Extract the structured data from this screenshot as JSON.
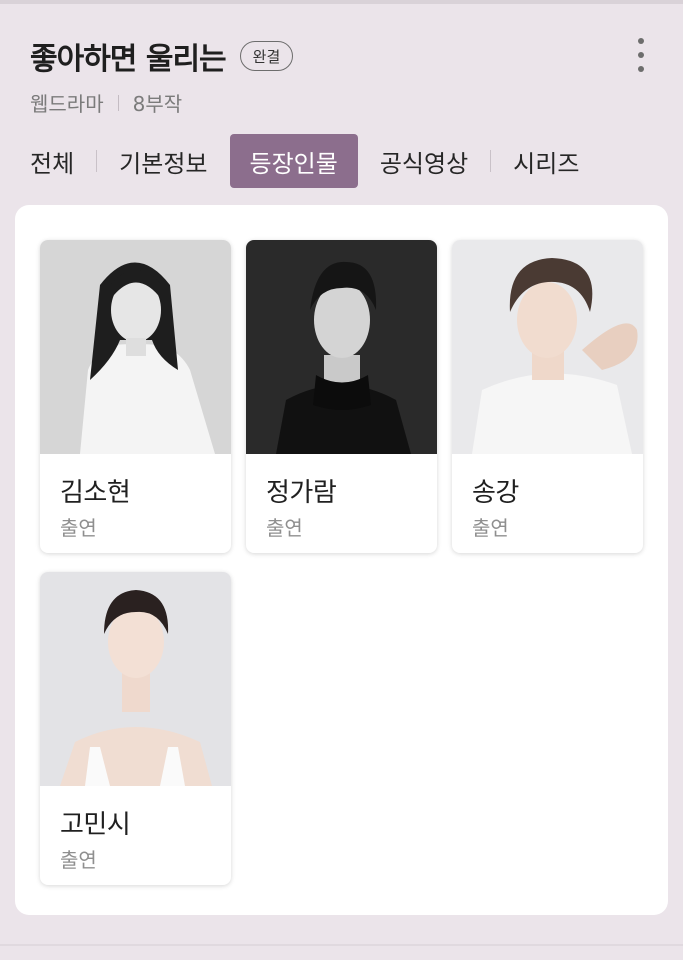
{
  "header": {
    "title": "좋아하면 울리는",
    "badge": "완결",
    "genre": "웹드라마",
    "episodes": "8부작"
  },
  "tabs": [
    {
      "label": "전체",
      "active": false
    },
    {
      "label": "기본정보",
      "active": false
    },
    {
      "label": "등장인물",
      "active": true
    },
    {
      "label": "공식영상",
      "active": false
    },
    {
      "label": "시리즈",
      "active": false
    }
  ],
  "cast": [
    {
      "name": "김소현",
      "role": "출연",
      "photo": "portrait-bw-woman"
    },
    {
      "name": "정가람",
      "role": "출연",
      "photo": "portrait-dark-man"
    },
    {
      "name": "송강",
      "role": "출연",
      "photo": "portrait-light-man"
    },
    {
      "name": "고민시",
      "role": "출연",
      "photo": "portrait-light-woman"
    }
  ],
  "colors": {
    "background": "#ebe4ea",
    "active_tab": "#8c6e8d",
    "panel": "#ffffff"
  }
}
